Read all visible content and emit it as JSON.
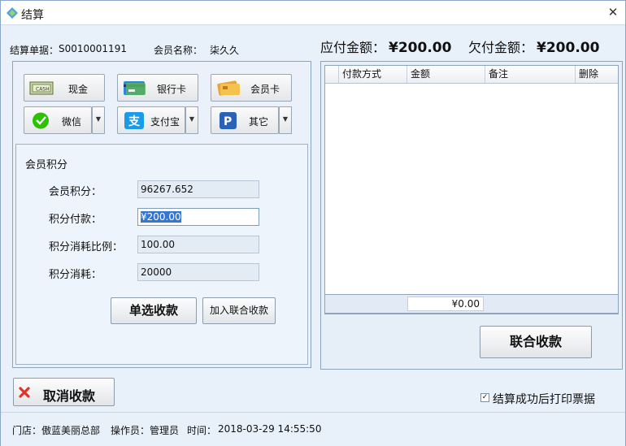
{
  "window": {
    "title": "结算"
  },
  "order": {
    "number_label": "结算单据：",
    "number": "S0010001191",
    "member_label": "会员名称：",
    "member_name": "柒久久"
  },
  "amounts": {
    "payable_label": "应付金额：",
    "payable": "¥200.00",
    "owed_label": "欠付金额：",
    "owed": "¥200.00"
  },
  "payment_methods": [
    {
      "label": "现金",
      "icon": "cash-icon"
    },
    {
      "label": "银行卡",
      "icon": "bank-card-icon"
    },
    {
      "label": "会员卡",
      "icon": "member-card-icon"
    },
    {
      "label": "微信",
      "icon": "wechat-icon"
    },
    {
      "label": "支付宝",
      "icon": "alipay-icon"
    },
    {
      "label": "其它",
      "icon": "paypal-icon"
    }
  ],
  "points": {
    "title": "会员积分",
    "balance_label": "会员积分：",
    "balance": "96267.652",
    "payment_label": "积分付款：",
    "payment": "¥200.00",
    "ratio_label": "积分消耗比例：",
    "ratio": "100.00",
    "consumed_label": "积分消耗：",
    "consumed": "20000"
  },
  "buttons": {
    "single_pay": "单选收款",
    "add_combined": "加入联合收款",
    "combined_pay": "联合收款",
    "cancel": "取消收款"
  },
  "table": {
    "columns": [
      "付款方式",
      "金额",
      "备注",
      "删除"
    ],
    "rows": [],
    "total": "¥0.00"
  },
  "print_option": {
    "label": "结算成功后打印票据",
    "checked": true
  },
  "status": {
    "store_label": "门店：",
    "store": "傲蓝美丽总部",
    "operator_label": "操作员：",
    "operator": "管理员",
    "time_label": "时间：",
    "time": "2018-03-29 14:55:50"
  },
  "colors": {
    "accent": "#3476d1",
    "cancel": "#e0342b",
    "wechat": "#2dc100",
    "alipay": "#1a9bea",
    "paypal": "#2a62b8"
  }
}
